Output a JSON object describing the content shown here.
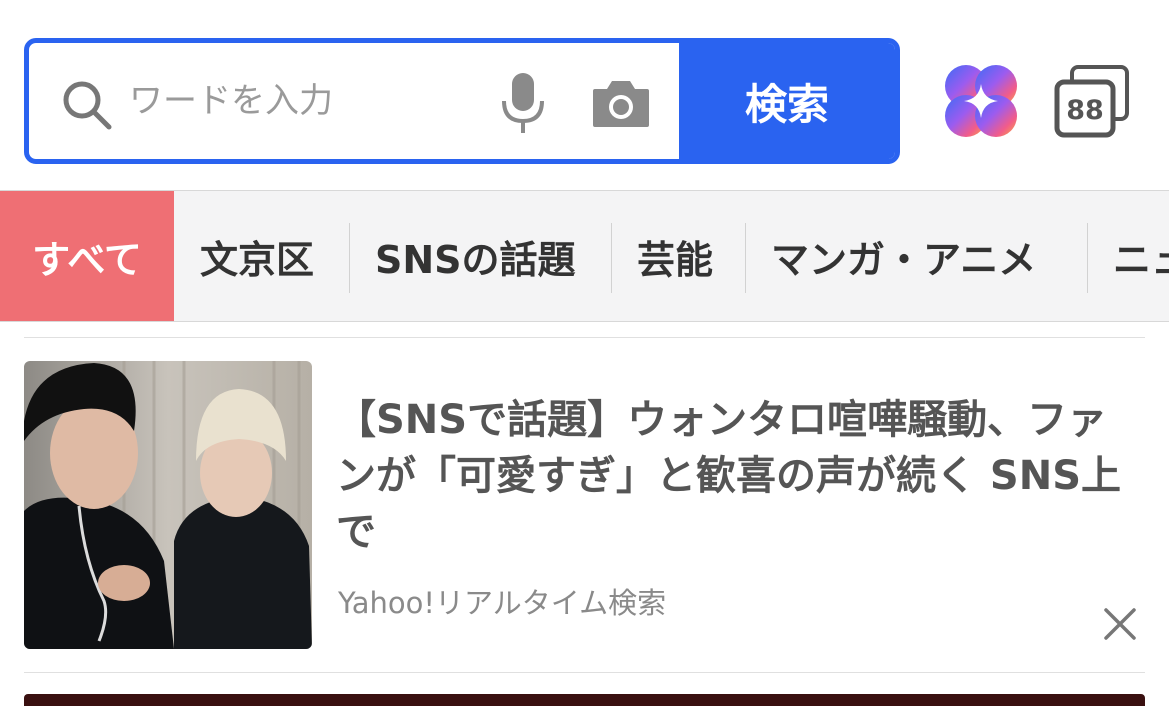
{
  "search": {
    "placeholder": "ワードを入力",
    "value": "",
    "button_label": "検索"
  },
  "header": {
    "tabs_count": "88"
  },
  "categories": [
    {
      "label": "すべて",
      "active": true
    },
    {
      "label": "文京区",
      "active": false
    },
    {
      "label": "SNSの話題",
      "active": false
    },
    {
      "label": "芸能",
      "active": false
    },
    {
      "label": "マンガ・アニメ",
      "active": false
    },
    {
      "label": "ニュ",
      "active": false
    }
  ],
  "article": {
    "headline": "【SNSで話題】ウォンタロ喧嘩騒動、ファンが「可愛すぎ」と歓喜の声が続く SNS上で",
    "source": "Yahoo!リアルタイム検索"
  },
  "icons": {
    "search": "search-icon",
    "mic": "microphone-icon",
    "camera": "camera-icon",
    "ai": "ai-sparkle-icon",
    "tabs": "tabs-icon",
    "close": "close-icon"
  },
  "colors": {
    "accent": "#2a63f0",
    "active_tab": "#ef6f74"
  }
}
